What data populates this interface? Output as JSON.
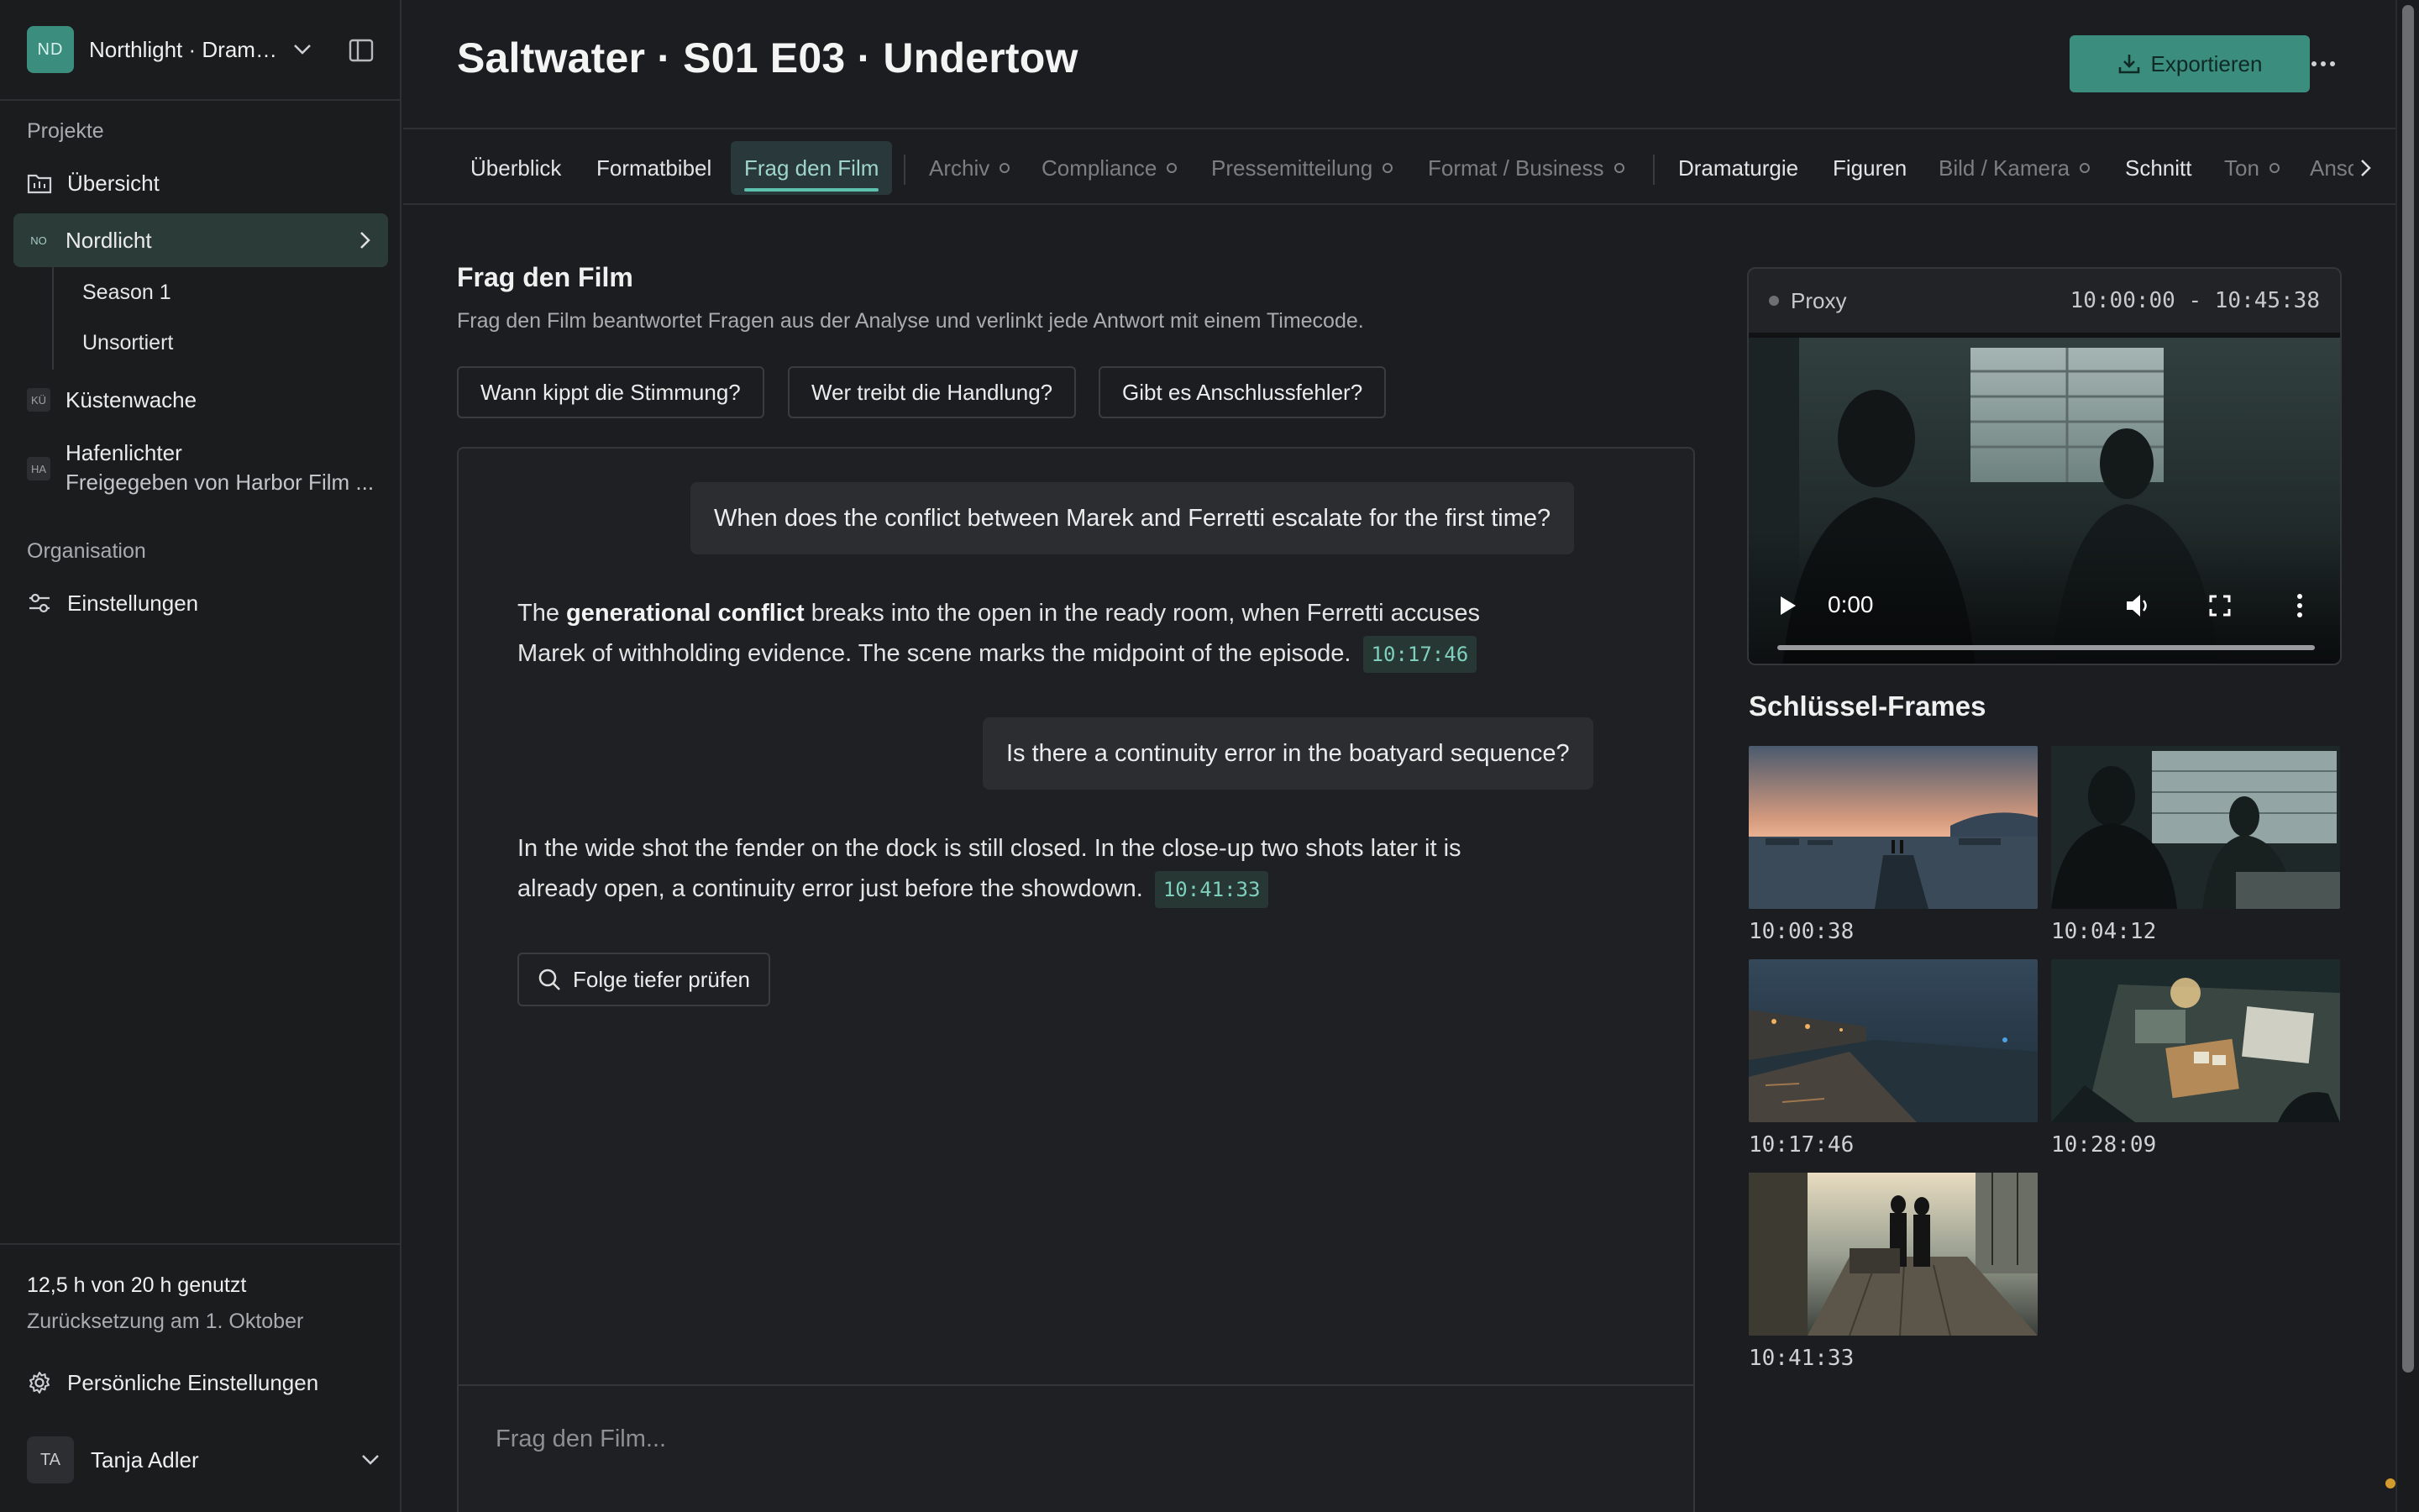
{
  "sidebar": {
    "workspace": {
      "initials": "ND",
      "name": "Northlight · Drama Studio"
    },
    "projects_label": "Projekte",
    "overview_label": "Übersicht",
    "projects": [
      {
        "initials": "NO",
        "name": "Nordlicht",
        "sub": [
          "Season 1",
          "Unsortiert"
        ]
      },
      {
        "initials": "KÜ",
        "name": "Küstenwache"
      },
      {
        "initials": "HA",
        "name": "Hafenlichter",
        "subtitle": "Freigegeben von Harbor Film ..."
      }
    ],
    "org_label": "Organisation",
    "settings_label": "Einstellungen",
    "usage": {
      "line1": "12,5 h von 20 h genutzt",
      "line2": "Zurücksetzung am 1. Oktober"
    },
    "personal_settings": "Persönliche Einstellungen",
    "user": {
      "initials": "TA",
      "name": "Tanja Adler"
    }
  },
  "header": {
    "title": "Saltwater · S01 E03 · Undertow",
    "export_label": "Exportieren"
  },
  "tabs": [
    {
      "label": "Überblick",
      "state": "enabled"
    },
    {
      "label": "Formatbibel",
      "state": "enabled"
    },
    {
      "label": "Frag den Film",
      "state": "active"
    },
    {
      "label": "Archiv",
      "state": "pending"
    },
    {
      "label": "Compliance",
      "state": "pending"
    },
    {
      "label": "Pressemitteilung",
      "state": "pending"
    },
    {
      "label": "Format / Business",
      "state": "pending"
    },
    {
      "label": "Dramaturgie",
      "state": "enabled"
    },
    {
      "label": "Figuren",
      "state": "enabled"
    },
    {
      "label": "Bild / Kamera",
      "state": "pending"
    },
    {
      "label": "Schnitt",
      "state": "enabled"
    },
    {
      "label": "Ton",
      "state": "pending"
    },
    {
      "label": "Ansc",
      "state": "pending"
    }
  ],
  "ask": {
    "title": "Frag den Film",
    "subtitle": "Frag den Film beantwortet Fragen aus der Analyse und verlinkt jede Antwort mit einem Timecode.",
    "suggestions": [
      "Wann kippt die Stimmung?",
      "Wer treibt die Handlung?",
      "Gibt es Anschlussfehler?"
    ],
    "messages": [
      {
        "role": "user",
        "text": "When does the conflict between Marek and Ferretti escalate for the first time?"
      },
      {
        "role": "assistant",
        "pre": "The ",
        "bold": "generational conflict",
        "line1_rest": " breaks into the open in the ready room, when Ferretti accuses",
        "line2": "Marek of withholding evidence. The scene marks the midpoint of the episode.",
        "timecode": "10:17:46"
      },
      {
        "role": "user",
        "text": "Is there a continuity error in the boatyard sequence?"
      },
      {
        "role": "assistant",
        "line1": "In the wide shot the fender on the dock is still closed. In the close-up two shots later it is",
        "line2": "already open, a continuity error just before the showdown.",
        "timecode": "10:41:33"
      }
    ],
    "deep_check_label": "Folge tiefer prüfen",
    "input_placeholder": "Frag den Film..."
  },
  "player": {
    "source_label": "Proxy",
    "range": "10:00:00 - 10:45:38",
    "current_time": "0:00"
  },
  "keyframes": {
    "title": "Schlüssel-Frames",
    "items": [
      {
        "timecode": "10:00:38",
        "scene": "harbor-sunset"
      },
      {
        "timecode": "10:04:12",
        "scene": "interrogation-room"
      },
      {
        "timecode": "10:17:46",
        "scene": "night-pier"
      },
      {
        "timecode": "10:28:09",
        "scene": "desk-evidence"
      },
      {
        "timecode": "10:41:33",
        "scene": "boat-deck-silhouettes"
      }
    ]
  },
  "colors": {
    "accent": "#3b8d7e",
    "accent_text": "#9fd6cb",
    "background": "#1c1d20",
    "panel": "#1f2023"
  }
}
